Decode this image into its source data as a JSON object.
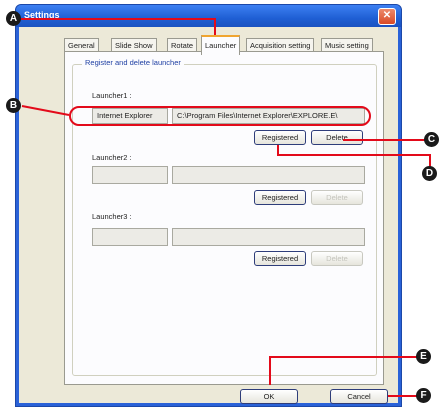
{
  "window": {
    "title": "Settings",
    "close_glyph": "✕"
  },
  "tabs": [
    {
      "label": "General"
    },
    {
      "label": "Slide Show"
    },
    {
      "label": "Rotate"
    },
    {
      "label": "Launcher"
    },
    {
      "label": "Acquisition setting"
    },
    {
      "label": "Music setting"
    }
  ],
  "active_tab": "Launcher",
  "group": {
    "title": "Register and delete launcher"
  },
  "launchers": [
    {
      "label": "Launcher1 :",
      "name": "Internet Explorer",
      "path": "C:\\Program Files\\Internet Explorer\\EXPLORE.E\\",
      "register_label": "Registered",
      "delete_label": "Delete",
      "delete_enabled": true
    },
    {
      "label": "Launcher2 :",
      "name": "",
      "path": "",
      "register_label": "Registered",
      "delete_label": "Delete",
      "delete_enabled": false
    },
    {
      "label": "Launcher3 :",
      "name": "",
      "path": "",
      "register_label": "Registered",
      "delete_label": "Delete",
      "delete_enabled": false
    }
  ],
  "footer": {
    "ok_label": "OK",
    "cancel_label": "Cancel"
  },
  "callouts": [
    "A",
    "B",
    "C",
    "D",
    "E",
    "F"
  ],
  "colors": {
    "callout_line": "#e30a1a",
    "title_bar": "#2a62d8",
    "active_tab_accent": "#f0a530"
  }
}
